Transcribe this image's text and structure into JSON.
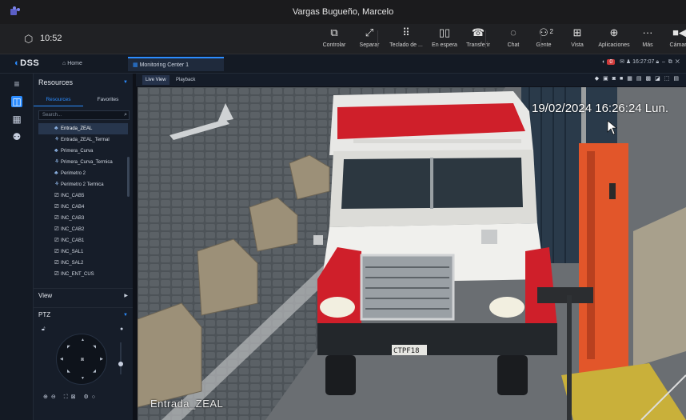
{
  "teams": {
    "window_title": "Vargas Bugueño, Marcelo",
    "clock": "10:52",
    "toolbar": [
      {
        "icon": "share-screen-icon",
        "glyph": "⧉",
        "label": "Controlar"
      },
      {
        "icon": "popout-icon",
        "glyph": "⤢",
        "label": "Separar"
      },
      {
        "icon": "dialpad-icon",
        "glyph": "⠿",
        "label": "Teclado de ..."
      },
      {
        "icon": "pause-icon",
        "glyph": "▯▯",
        "label": "En espera"
      },
      {
        "icon": "transfer-icon",
        "glyph": "☎",
        "label": "Transferir"
      },
      {
        "icon": "chat-icon",
        "glyph": "◌",
        "label": "Chat"
      },
      {
        "icon": "people-icon",
        "glyph": "⚇",
        "label": "Gente",
        "badge": "2"
      },
      {
        "icon": "view-icon",
        "glyph": "⊞",
        "label": "Vista"
      },
      {
        "icon": "apps-icon",
        "glyph": "⊕",
        "label": "Aplicaciones"
      },
      {
        "icon": "more-icon",
        "glyph": "···",
        "label": "Más"
      },
      {
        "icon": "camera-icon",
        "glyph": "■◀",
        "label": "Cámara"
      }
    ]
  },
  "dss": {
    "logo": "DSS",
    "home_tab": "Home",
    "active_tab": "Monitoring Center 1",
    "alarm_count": "0",
    "status_time": "16:27:07",
    "sidebar_title": "Resources",
    "tabs": [
      "Resources",
      "Favorites"
    ],
    "search_placeholder": "Search...",
    "tree": [
      {
        "label": "Entrada_ZEAL",
        "type": "ptz",
        "selected": true
      },
      {
        "label": "Entrada_ZEAL_Termal",
        "type": "thermal"
      },
      {
        "label": "Primera_Curva",
        "type": "ptz"
      },
      {
        "label": "Primera_Curva_Termica",
        "type": "thermal"
      },
      {
        "label": "Perimetro 2",
        "type": "ptz"
      },
      {
        "label": "Perimetro 2 Termica",
        "type": "thermal"
      },
      {
        "label": "INC_CAB5",
        "type": "camera"
      },
      {
        "label": "INC_CAB4",
        "type": "camera"
      },
      {
        "label": "INC_CAB3",
        "type": "camera"
      },
      {
        "label": "INC_CAB2",
        "type": "camera"
      },
      {
        "label": "INC_CAB1",
        "type": "camera"
      },
      {
        "label": "INC_SAL1",
        "type": "camera"
      },
      {
        "label": "INC_SAL2",
        "type": "camera"
      },
      {
        "label": "INC_ENT_CUS",
        "type": "camera"
      }
    ],
    "section_view": "View",
    "section_ptz": "PTZ",
    "viewer_tabs": [
      "Live View",
      "Playback"
    ],
    "video_timestamp": "19/02/2024 16:26:24 Lun.",
    "video_camera_name": "Entrada_ZEAL",
    "plate": "CTPF18"
  },
  "colors": {
    "accent": "#2b8cff",
    "alarm": "#d03a3a",
    "truck_red": "#cf1f2a",
    "barrier_orange": "#e2562a"
  }
}
